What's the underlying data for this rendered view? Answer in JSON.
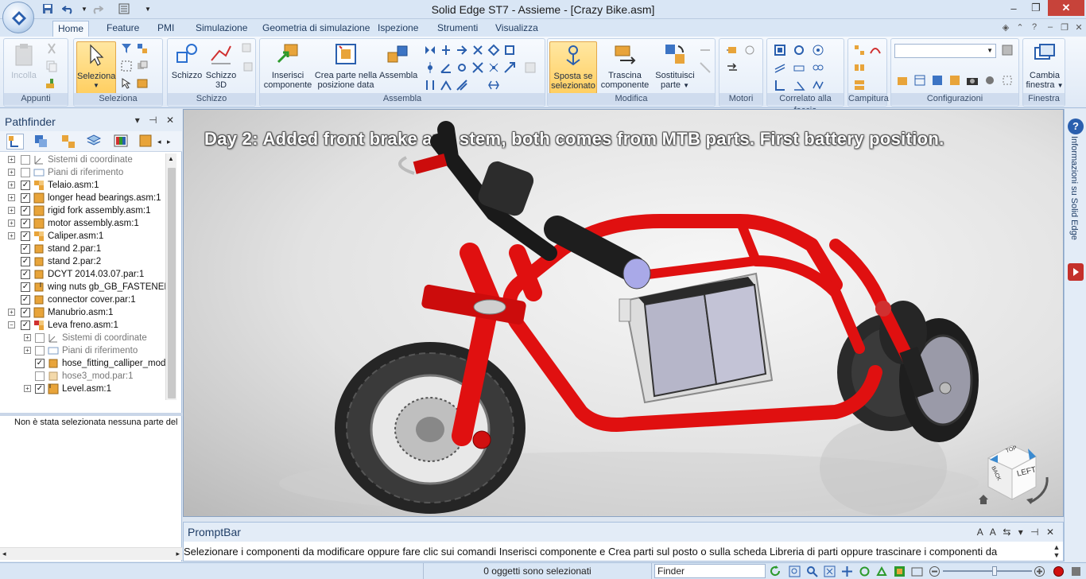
{
  "window": {
    "title": "Solid Edge ST7 - Assieme - [Crazy Bike.asm]",
    "controls": {
      "minimize": "–",
      "restore": "❐",
      "close": "✕"
    }
  },
  "tabs": [
    {
      "label": "Home",
      "active": true
    },
    {
      "label": "Feature"
    },
    {
      "label": "PMI"
    },
    {
      "label": "Simulazione"
    },
    {
      "label": "Geometria di simulazione"
    },
    {
      "label": "Ispezione"
    },
    {
      "label": "Strumenti"
    },
    {
      "label": "Visualizza"
    }
  ],
  "ribbon": {
    "appunti": {
      "label": "Appunti",
      "incolla": "Incolla"
    },
    "seleziona": {
      "label": "Seleziona",
      "seleziona": "Seleziona"
    },
    "schizzo": {
      "label": "Schizzo",
      "schizzo": "Schizzo",
      "schizzo3d_line1": "Schizzo",
      "schizzo3d_line2": "3D"
    },
    "assembla": {
      "label": "Assembla",
      "inserisci_line1": "Inserisci",
      "inserisci_line2": "componente",
      "crea_line1": "Crea parte nella",
      "crea_line2": "posizione data",
      "assembla": "Assembla"
    },
    "modifica": {
      "label": "Modifica",
      "sposta_line1": "Sposta se",
      "sposta_line2": "selezionato",
      "trascina_line1": "Trascina",
      "trascina_line2": "componente",
      "sostituisci_line1": "Sostituisci",
      "sostituisci_line2": "parte"
    },
    "motori": {
      "label": "Motori"
    },
    "correlato": {
      "label": "Correlato alla faccia"
    },
    "campitura": {
      "label": "Campitura"
    },
    "configurazioni": {
      "label": "Configurazioni"
    },
    "finestra": {
      "label": "Finestra",
      "cambia_line1": "Cambia",
      "cambia_line2": "finestra"
    }
  },
  "pathfinder": {
    "title": "Pathfinder",
    "tree": [
      {
        "label": "Sistemi di coordinate",
        "checked": false,
        "dim": true
      },
      {
        "label": "Piani di riferimento",
        "checked": false,
        "dim": true
      },
      {
        "label": "Telaio.asm:1",
        "checked": true
      },
      {
        "label": "longer head bearings.asm:1",
        "checked": true
      },
      {
        "label": "rigid fork assembly.asm:1",
        "checked": true
      },
      {
        "label": "motor assembly.asm:1",
        "checked": true
      },
      {
        "label": "Caliper.asm:1",
        "checked": true
      },
      {
        "label": "stand 2.par:1",
        "checked": true
      },
      {
        "label": "stand 2.par:2",
        "checked": true
      },
      {
        "label": "DCYT 2014.03.07.par:1",
        "checked": true
      },
      {
        "label": "wing nuts gb_GB_FASTENER_",
        "checked": true
      },
      {
        "label": "connector cover.par:1",
        "checked": true
      },
      {
        "label": "Manubrio.asm:1",
        "checked": true
      },
      {
        "label": "Leva freno.asm:1",
        "checked": true
      },
      {
        "label": "Sistemi di coordinate",
        "checked": false,
        "dim": true
      },
      {
        "label": "Piani di riferimento",
        "checked": false,
        "dim": true
      },
      {
        "label": "hose_fitting_calliper_mod.p",
        "checked": true
      },
      {
        "label": "hose3_mod.par:1",
        "checked": false,
        "dim": true
      },
      {
        "label": "Level.asm:1",
        "checked": true
      }
    ],
    "status": "Non è stata selezionata nessuna parte del li"
  },
  "viewport": {
    "caption_day": "Day 2:",
    "caption_text": "Added front brake and stem, both comes from MTB parts. First battery position.",
    "view_cube": {
      "front_label": "LEFT",
      "top_label": "TOP",
      "side_label": "BACK"
    }
  },
  "right_rail": {
    "label": "Informazioni su Solid Edge",
    "help": "?"
  },
  "promptbar": {
    "title": "PromptBar",
    "text": "Selezionare i componenti da modificare oppure fare clic sui comandi Inserisci componente e Crea parti sul posto o sulla scheda Libreria di parti oppure trascinare i componenti da"
  },
  "statusbar": {
    "selected": "0 oggetti sono selezionati",
    "finder": "Finder"
  },
  "colors": {
    "accent": "#d9e6f5",
    "frame_red": "#e01010",
    "ribbon_active": "#ffcf62"
  }
}
